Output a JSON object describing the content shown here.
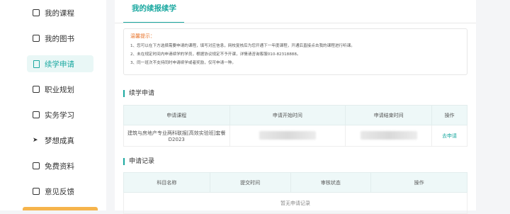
{
  "sidebar": {
    "items": [
      {
        "label": "我的课程",
        "icon": "bookmark-icon",
        "active": false
      },
      {
        "label": "我的图书",
        "icon": "book-icon",
        "active": false
      },
      {
        "label": "续学申请",
        "icon": "edit-icon",
        "active": true
      },
      {
        "label": "职业规划",
        "icon": "badge-icon",
        "active": false
      },
      {
        "label": "实务学习",
        "icon": "monitor-icon",
        "active": false
      },
      {
        "label": "梦想成真",
        "icon": "plane-icon",
        "active": false
      },
      {
        "label": "免费资料",
        "icon": "folder-icon",
        "active": false
      },
      {
        "label": "意见反馈",
        "icon": "mail-icon",
        "active": false
      }
    ]
  },
  "tab": {
    "label": "我的续报续学"
  },
  "notice": {
    "title": "温馨提示：",
    "lines": [
      "1、您可以在下方选择需要申请的课程，填写对应信息，网校复核后为您开通下一年度课程，开通后直接点击我的课程进行听课。",
      "2、未在规定时间内申请续学的学员，根据协议规定不予开课，详情请咨询客服010-82318888。",
      "3、同一班次不支持同时申请续学或者奖励，仅可申请一种。"
    ]
  },
  "apply": {
    "title": "续学申请",
    "headers": [
      "申请课程",
      "申请开始时间",
      "申请结束时间",
      "操作"
    ],
    "rows": [
      {
        "course": "建筑与房地产专业两科联报[高效实验班]套餐D2023",
        "action": "去申请"
      }
    ]
  },
  "records": {
    "title": "申请记录",
    "headers": [
      "科目名称",
      "提交时间",
      "审核状态",
      "操作"
    ],
    "empty": "暂无申请记录"
  },
  "colors": {
    "accent": "#1aa8a0",
    "warning": "#e8742b"
  }
}
